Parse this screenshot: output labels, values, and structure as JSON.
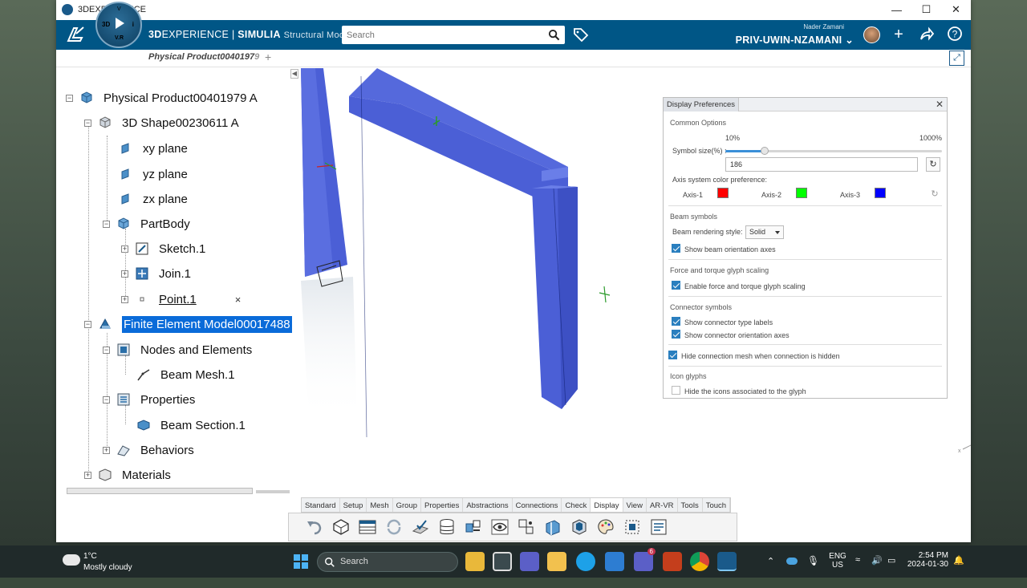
{
  "window": {
    "title": "3DEXPERIENCE"
  },
  "topbar": {
    "brand_3d": "3D",
    "brand_exp": "EXPERIENCE",
    "brand_sep": " | ",
    "brand_app": "SIMULIA",
    "brand_sub": "Structural Mod...",
    "compass_3d": "3D",
    "compass_vr": "V.R",
    "compass_i": "i",
    "search_placeholder": "Search",
    "user_name": "Nader Zamani",
    "tenant": "PRIV-UWIN-NZAMANI"
  },
  "tab": {
    "label": "Physical Product0040197",
    "label_fade": "9"
  },
  "tree": {
    "items": [
      {
        "label": "Physical Product00401979 A"
      },
      {
        "label": "3D Shape00230611 A"
      },
      {
        "label": "xy plane"
      },
      {
        "label": "yz plane"
      },
      {
        "label": "zx plane"
      },
      {
        "label": "PartBody"
      },
      {
        "label": "Sketch.1"
      },
      {
        "label": "Join.1"
      },
      {
        "label": "Point.1"
      },
      {
        "label": "Finite Element Model00017488"
      },
      {
        "label": "Nodes and Elements"
      },
      {
        "label": "Beam Mesh.1"
      },
      {
        "label": "Properties"
      },
      {
        "label": "Beam Section.1"
      },
      {
        "label": "Behaviors"
      },
      {
        "label": "Materials"
      }
    ]
  },
  "display_prefs": {
    "title": "Display Preferences",
    "common_options": "Common Options",
    "min_label": "10%",
    "max_label": "1000%",
    "symbol_size_label": "Symbol size(%) :",
    "symbol_size_value": "186",
    "symbol_size_fraction": 0.18,
    "axis_pref_label": "Axis system color preference:",
    "axes": [
      {
        "label": "Axis-1",
        "color": "#ff0000"
      },
      {
        "label": "Axis-2",
        "color": "#00ff00"
      },
      {
        "label": "Axis-3",
        "color": "#0000ff"
      }
    ],
    "beam_symbols": "Beam symbols",
    "beam_style_label": "Beam rendering style:",
    "beam_style_value": "Solid",
    "show_beam_axes": "Show beam orientation axes",
    "force_section": "Force and torque glyph scaling",
    "enable_force": "Enable force and torque glyph scaling",
    "connector_section": "Connector symbols",
    "show_connector_labels": "Show connector type labels",
    "show_connector_axes": "Show connector orientation axes",
    "hide_connection_mesh": "Hide connection mesh when connection is hidden",
    "icon_glyphs": "Icon glyphs",
    "hide_icons": "Hide the icons associated to the glyph"
  },
  "action_bar": {
    "tabs": [
      "Standard",
      "Setup",
      "Mesh",
      "Group",
      "Properties",
      "Abstractions",
      "Connections",
      "Check",
      "Display",
      "View",
      "AR-VR",
      "Tools",
      "Touch"
    ],
    "active_tab": "Display"
  },
  "taskbar": {
    "temp": "1°C",
    "condition": "Mostly cloudy",
    "search": "Search",
    "lang1": "ENG",
    "lang2": "US",
    "time": "2:54 PM",
    "date": "2024-01-30",
    "teams_badge": "6"
  }
}
